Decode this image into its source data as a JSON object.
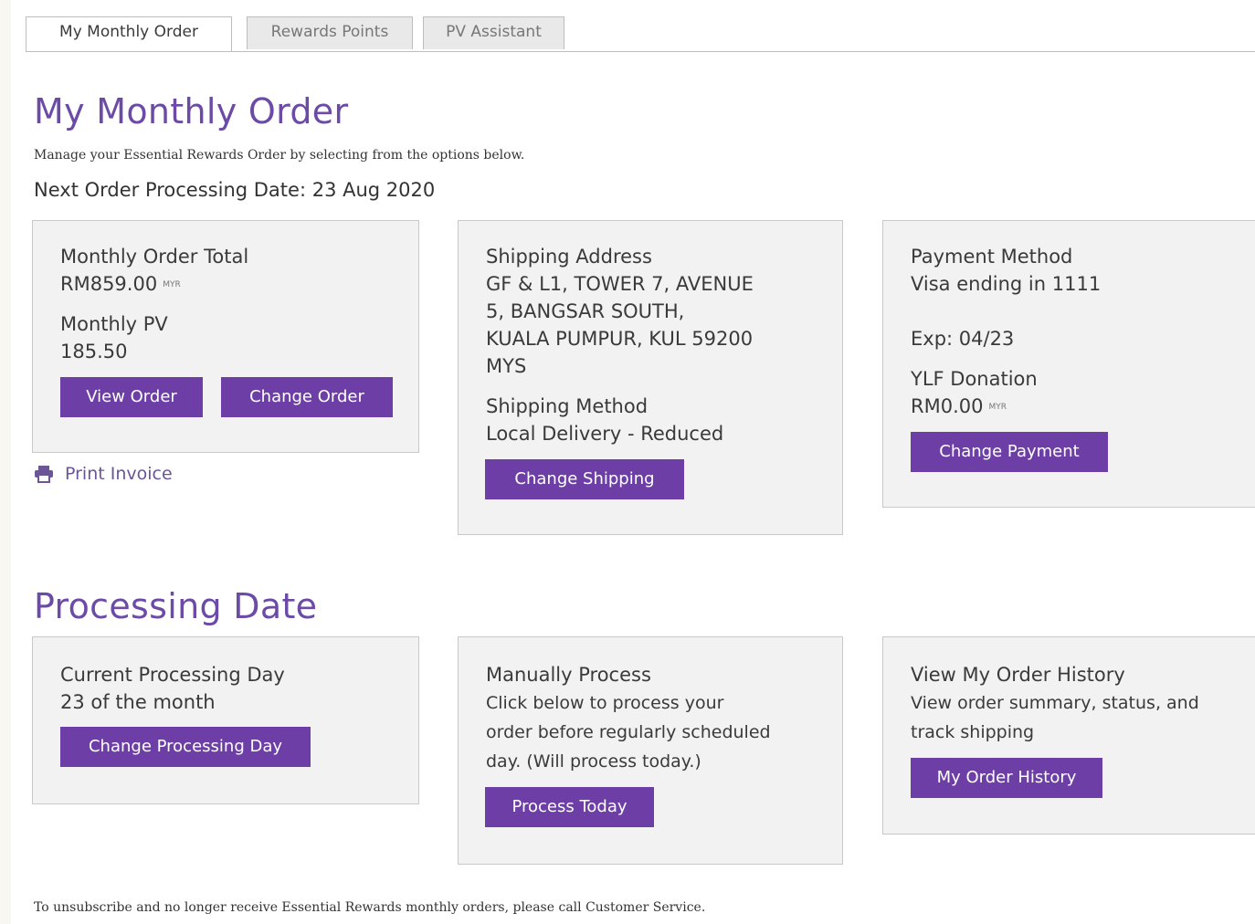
{
  "tabs": [
    "My Monthly Order",
    "Rewards Points",
    "PV Assistant"
  ],
  "monthly": {
    "heading": "My Monthly Order",
    "subtitle": "Manage your Essential Rewards Order by selecting from the options below.",
    "next_date": "Next Order Processing Date: 23 Aug 2020"
  },
  "order_card": {
    "total_label": "Monthly Order Total",
    "total_value": "RM859.00",
    "currency": "MYR",
    "pv_label": "Monthly PV",
    "pv_value": "185.50",
    "view_btn": "View Order",
    "change_btn": "Change Order"
  },
  "print_invoice": "Print Invoice",
  "shipping_card": {
    "address_label": "Shipping Address",
    "address_lines": [
      "GF & L1, TOWER 7, AVENUE",
      "5, BANGSAR SOUTH,",
      "KUALA PUMPUR, KUL 59200",
      "MYS"
    ],
    "method_label": "Shipping Method",
    "method_value": "Local Delivery - Reduced",
    "change_btn": "Change Shipping"
  },
  "payment_card": {
    "method_label": "Payment Method",
    "method_value": "Visa ending in 1111",
    "exp": "Exp: 04/23",
    "donation_label": "YLF Donation",
    "donation_value": "RM0.00",
    "currency": "MYR",
    "change_btn": "Change Payment"
  },
  "processing": {
    "heading": "Processing Date",
    "current": {
      "label": "Current Processing Day",
      "value": "23 of the month",
      "btn": "Change Processing Day"
    },
    "manual": {
      "label": "Manually Process",
      "desc_lines": [
        "Click below to process your",
        "order before regularly scheduled",
        "day. (Will process today.)"
      ],
      "btn": "Process Today"
    },
    "history": {
      "label": "View My Order History",
      "desc_lines": [
        "View order summary, status, and",
        "track shipping"
      ],
      "btn": "My Order History"
    }
  },
  "footer": "To unsubscribe and no longer receive Essential Rewards monthly orders, please call Customer Service.",
  "colors": {
    "accent": "#6d3fa6",
    "heading": "#6b4ba6",
    "card_bg": "#f2f2f2"
  }
}
